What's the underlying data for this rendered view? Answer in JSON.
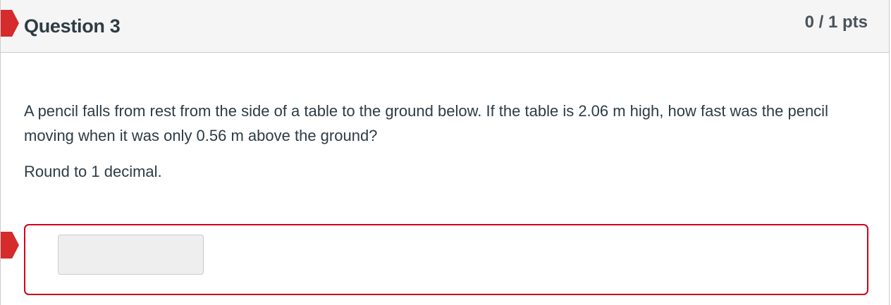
{
  "question": {
    "title": "Question 3",
    "points": "0 / 1 pts",
    "text": "A pencil falls from rest from the side of a table to the ground below. If the table is 2.06 m high, how fast was the pencil moving when it was only 0.56 m above the ground?",
    "instruction": "Round to 1 decimal.",
    "answer": {
      "value": "",
      "status": "incorrect",
      "status_color": "#d0021b"
    }
  },
  "colors": {
    "flag": "#d52b2b",
    "header_bg": "#f5f5f5",
    "text": "#2d3b45"
  }
}
